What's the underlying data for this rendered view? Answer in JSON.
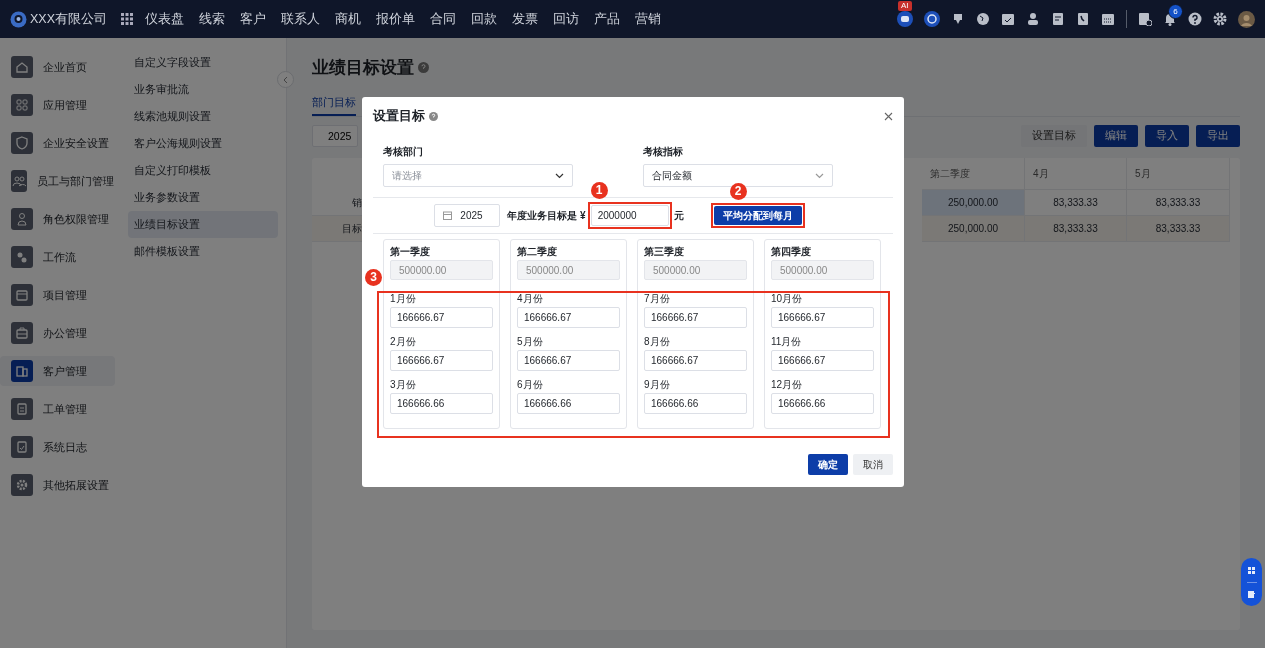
{
  "topbar": {
    "company": "XXX有限公司",
    "nav": [
      "仪表盘",
      "线索",
      "客户",
      "联系人",
      "商机",
      "报价单",
      "合同",
      "回款",
      "发票",
      "回访",
      "产品",
      "营销"
    ],
    "ai_badge": "AI",
    "notification_count": "6"
  },
  "sidebar": {
    "items": [
      {
        "label": "企业首页",
        "selected": false
      },
      {
        "label": "应用管理",
        "selected": false
      },
      {
        "label": "企业安全设置",
        "selected": false
      },
      {
        "label": "员工与部门管理",
        "selected": false
      },
      {
        "label": "角色权限管理",
        "selected": false
      },
      {
        "label": "工作流",
        "selected": false
      },
      {
        "label": "项目管理",
        "selected": false
      },
      {
        "label": "办公管理",
        "selected": false
      },
      {
        "label": "客户管理",
        "selected": true
      },
      {
        "label": "工单管理",
        "selected": false
      },
      {
        "label": "系统日志",
        "selected": false
      },
      {
        "label": "其他拓展设置",
        "selected": false
      }
    ]
  },
  "submenu": {
    "items": [
      {
        "label": "自定义字段设置",
        "selected": false
      },
      {
        "label": "业务审批流",
        "selected": false
      },
      {
        "label": "线索池规则设置",
        "selected": false
      },
      {
        "label": "客户公海规则设置",
        "selected": false
      },
      {
        "label": "自定义打印模板",
        "selected": false
      },
      {
        "label": "业务参数设置",
        "selected": false
      },
      {
        "label": "业绩目标设置",
        "selected": true
      },
      {
        "label": "邮件模板设置",
        "selected": false
      }
    ]
  },
  "page": {
    "title": "业绩目标设置",
    "tabs": [
      {
        "label": "部门目标",
        "selected": true
      }
    ],
    "year": "2025",
    "buttons": [
      {
        "label": "设置目标",
        "kind": "default"
      },
      {
        "label": "编辑",
        "kind": "primary"
      },
      {
        "label": "导入",
        "kind": "primary"
      },
      {
        "label": "导出",
        "kind": "primary"
      }
    ],
    "table": {
      "columns": [
        "第二季度",
        "4月",
        "5月"
      ],
      "rows": [
        {
          "label": "销",
          "cells": [
            "250,000.00",
            "83,333.33",
            "83,333.33"
          ]
        },
        {
          "label": "目标",
          "cells": [
            "250,000.00",
            "83,333.33",
            "83,333.33"
          ]
        }
      ]
    }
  },
  "dialog": {
    "title": "设置目标",
    "department": {
      "label": "考核部门",
      "placeholder": "请选择"
    },
    "metric": {
      "label": "考核指标",
      "value": "合同金额"
    },
    "year": "2025",
    "target_label": "年度业务目标是 ¥",
    "target_value": "2000000",
    "unit": "元",
    "distribute_button": "平均分配到每月",
    "quarters": [
      {
        "name": "第一季度",
        "total": "500000.00",
        "months": [
          {
            "label": "1月份",
            "value": "166666.67"
          },
          {
            "label": "2月份",
            "value": "166666.67"
          },
          {
            "label": "3月份",
            "value": "166666.66"
          }
        ]
      },
      {
        "name": "第二季度",
        "total": "500000.00",
        "months": [
          {
            "label": "4月份",
            "value": "166666.67"
          },
          {
            "label": "5月份",
            "value": "166666.67"
          },
          {
            "label": "6月份",
            "value": "166666.66"
          }
        ]
      },
      {
        "name": "第三季度",
        "total": "500000.00",
        "months": [
          {
            "label": "7月份",
            "value": "166666.67"
          },
          {
            "label": "8月份",
            "value": "166666.67"
          },
          {
            "label": "9月份",
            "value": "166666.66"
          }
        ]
      },
      {
        "name": "第四季度",
        "total": "500000.00",
        "months": [
          {
            "label": "10月份",
            "value": "166666.67"
          },
          {
            "label": "11月份",
            "value": "166666.67"
          },
          {
            "label": "12月份",
            "value": "166666.66"
          }
        ]
      }
    ],
    "confirm": "确定",
    "cancel": "取消",
    "annotations": [
      "1",
      "2",
      "3"
    ]
  }
}
